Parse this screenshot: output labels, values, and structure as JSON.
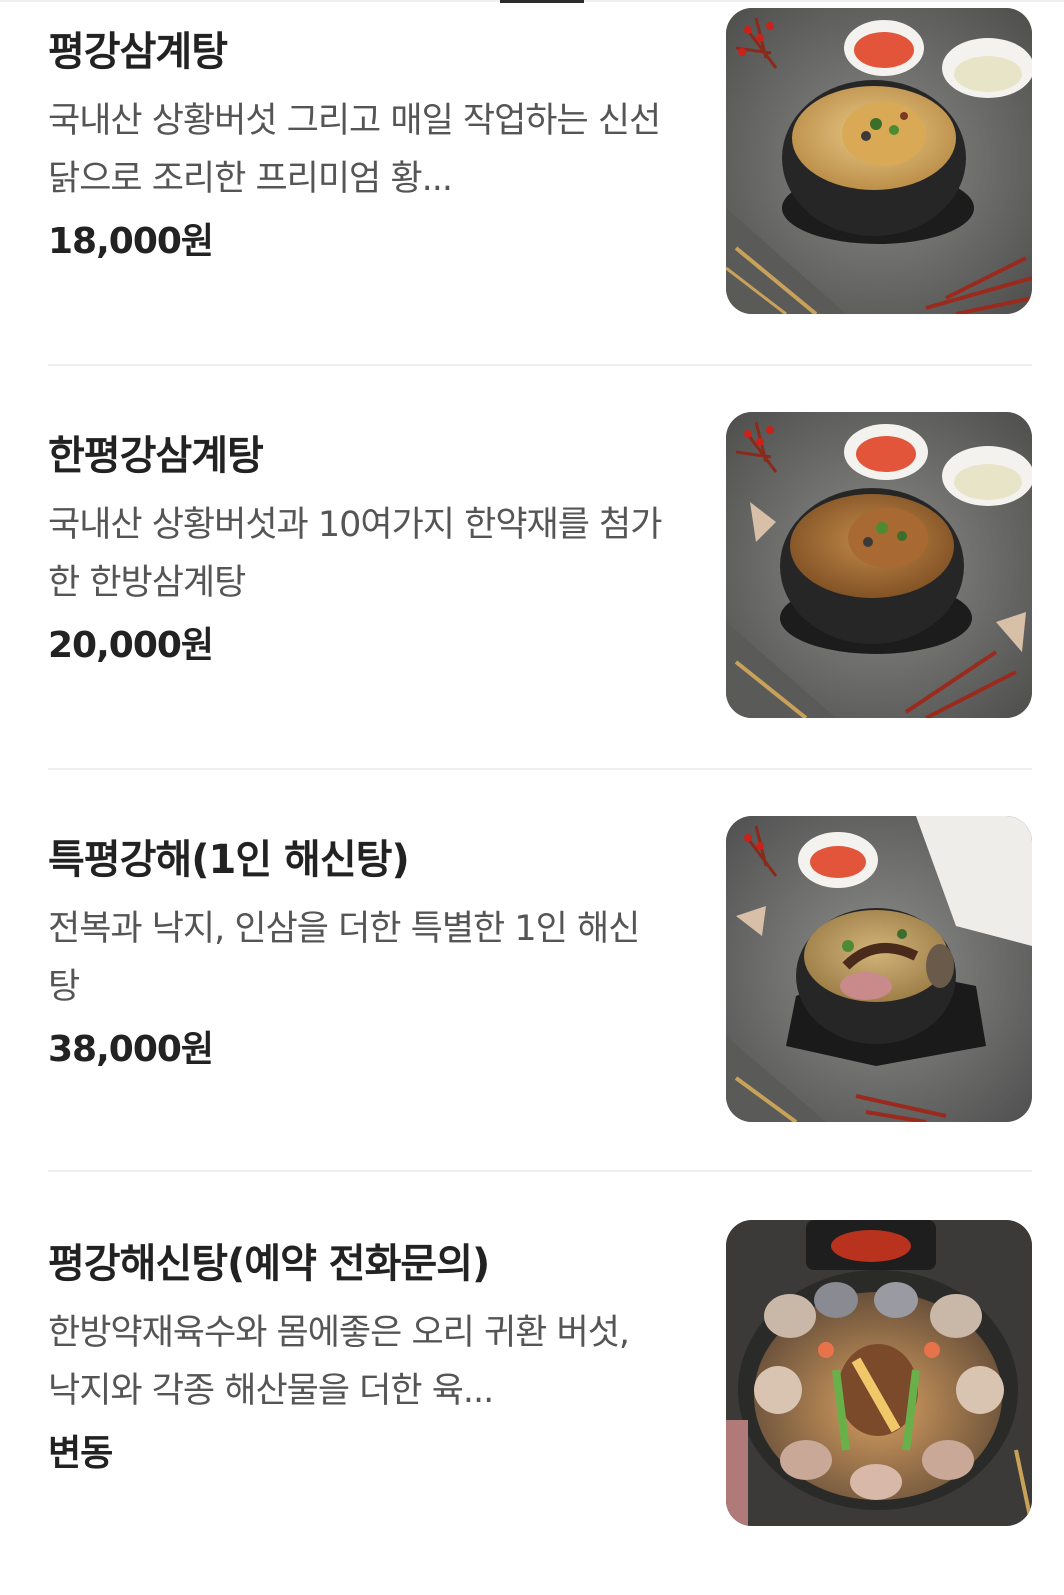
{
  "menu": {
    "items": [
      {
        "name": "평강삼계탕",
        "description": "국내산 상황버섯 그리고 매일 작업하는 신선닭으로 조리한 프리미엄 황...",
        "price": "18,000원",
        "photo_icon": "samgyetang-clay-pot-photo"
      },
      {
        "name": "한평강삼계탕",
        "description": "국내산 상황버섯과 10여가지 한약재를 첨가한 한방삼계탕",
        "price": "20,000원",
        "photo_icon": "herbal-samgyetang-clay-pot-photo"
      },
      {
        "name": "특평강해(1인 해신탕)",
        "description": "전복과 낙지, 인삼을 더한 특별한 1인 해신탕",
        "price": "38,000원",
        "photo_icon": "seafood-soup-clay-pot-photo"
      },
      {
        "name": "평강해신탕(예약 전화문의)",
        "description": "한방약재육수와 몸에좋은 오리 귀환 버섯, 낙지와 각종 해산물을 더한 육...",
        "price": "변동",
        "photo_icon": "seafood-platter-pot-photo"
      }
    ]
  },
  "colors": {
    "text_primary": "#222222",
    "text_secondary": "#555555",
    "divider": "#eeeeee",
    "photo_background": "#6f6f6f"
  }
}
